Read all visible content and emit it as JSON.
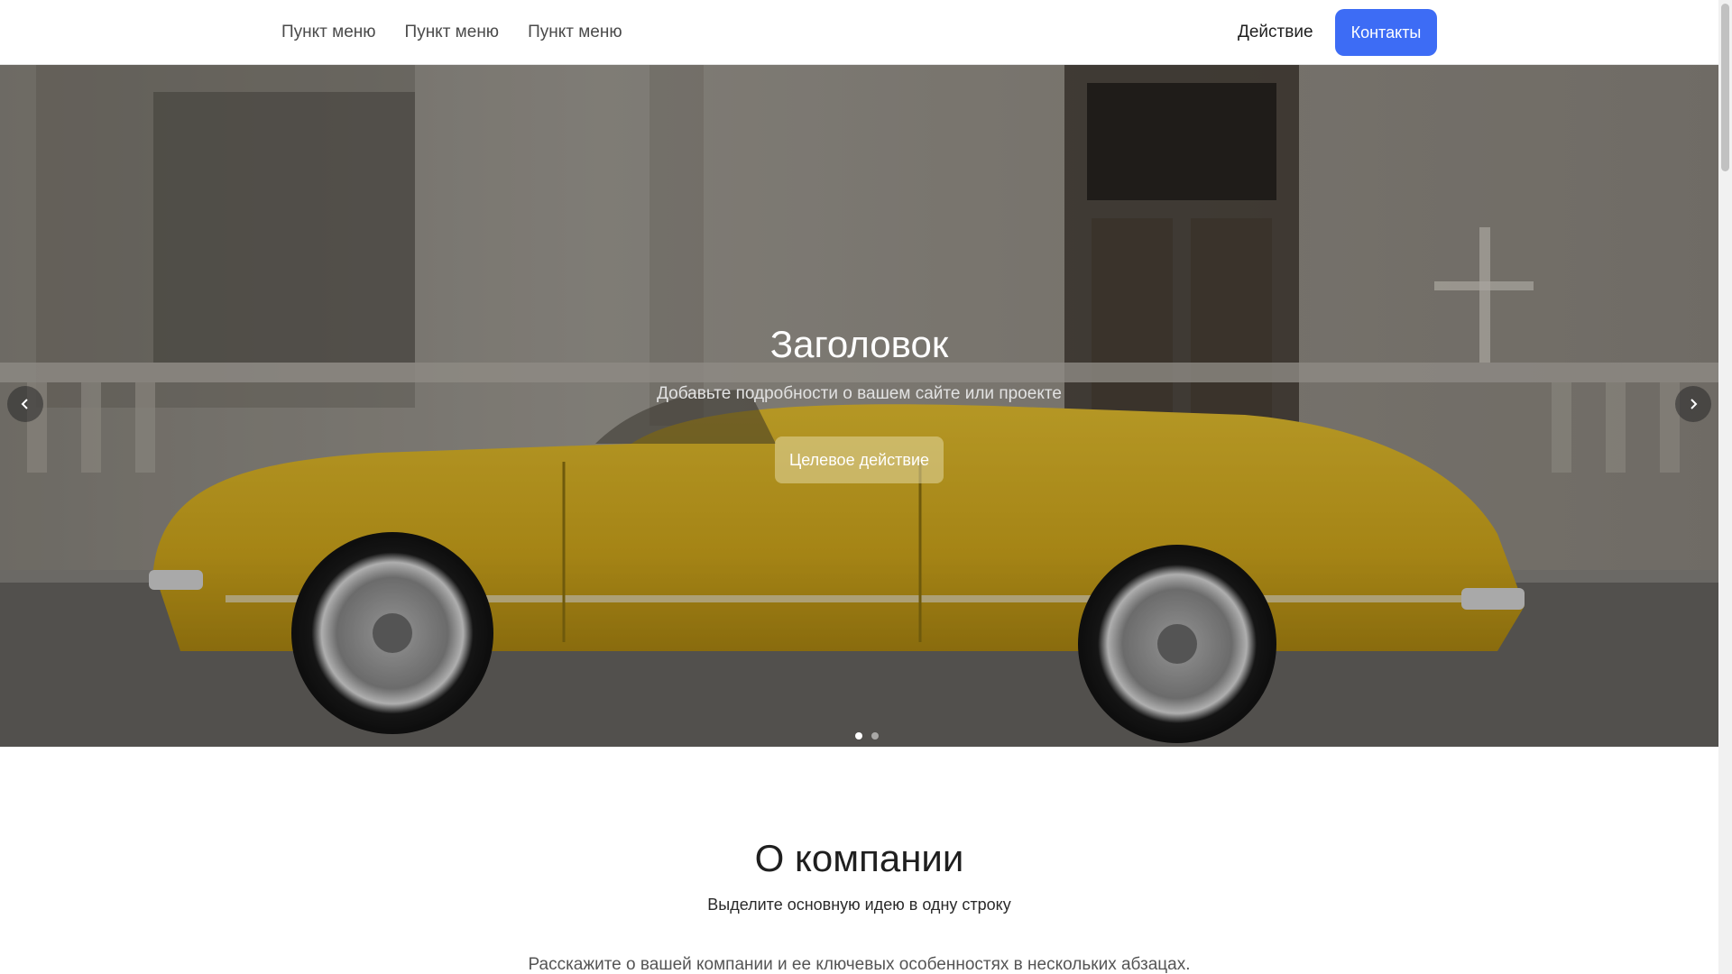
{
  "header": {
    "nav_items": [
      {
        "label": "Пункт меню"
      },
      {
        "label": "Пункт меню"
      },
      {
        "label": "Пункт меню"
      }
    ],
    "action_label": "Действие",
    "contact_label": "Контакты",
    "accent_color": "#3d6cf5"
  },
  "hero": {
    "title": "Заголовок",
    "subtitle": "Добавьте подробности о вашем сайте или проекте",
    "cta_label": "Целевое действие",
    "prev_icon": "chevron-left-icon",
    "next_icon": "chevron-right-icon",
    "slides_count": 2,
    "active_slide": 1,
    "background": "photo of yellow vintage convertible car in front of weathered wall"
  },
  "about": {
    "title": "О компании",
    "lead": "Выделите основную идею в одну строку",
    "text": "Расскажите о вашей компании и ее ключевых особенностях в нескольких абзацах."
  }
}
